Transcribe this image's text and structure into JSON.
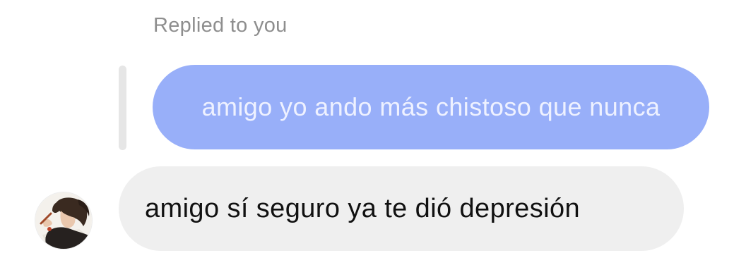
{
  "reply_context": "Replied to you",
  "quoted_message": {
    "text": "amigo yo ando más chistoso que nunca",
    "bubble_color": "#98aff9"
  },
  "reply_message": {
    "text": "amigo sí seguro ya te dió depresión",
    "bubble_color": "#efefef"
  },
  "sender": {
    "avatar_icon": "avatar-illustration"
  }
}
